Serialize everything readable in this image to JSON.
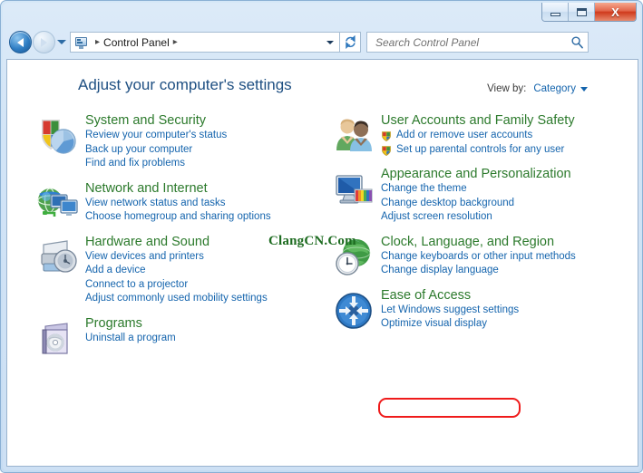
{
  "window": {
    "buttons": {
      "minimize": "minimize",
      "maximize": "maximize",
      "close": "X"
    }
  },
  "addressbar": {
    "icon": "control-panel-icon",
    "crumb": "Control Panel",
    "separator": "▸",
    "back_icon": "back-arrow-icon",
    "forward_icon": "forward-arrow-icon",
    "history_icon": "chevron-down-icon",
    "dropdown_icon": "chevron-down-icon",
    "refresh_icon": "refresh-icon"
  },
  "search": {
    "placeholder": "Search Control Panel",
    "value": "",
    "icon": "search-icon"
  },
  "main": {
    "title": "Adjust your computer's settings",
    "view_by_label": "View by:",
    "view_by_value": "Category",
    "view_by_caret": "chevron-down-icon"
  },
  "watermark": "ClangCN.Com",
  "highlight": {
    "color": "#ef1b1b",
    "target": "Change display language"
  },
  "colors": {
    "category_title": "#2c7a2c",
    "link": "#1464ad",
    "page_title": "#1e4f82",
    "highlight": "#ef1b1b",
    "watermark": "#1d6b20"
  },
  "categories_left": [
    {
      "title": "System and Security",
      "icon": "shield-security-icon",
      "links": [
        {
          "label": "Review your computer's status",
          "shield": false
        },
        {
          "label": "Back up your computer",
          "shield": false
        },
        {
          "label": "Find and fix problems",
          "shield": false
        }
      ]
    },
    {
      "title": "Network and Internet",
      "icon": "network-globe-icon",
      "links": [
        {
          "label": "View network status and tasks",
          "shield": false
        },
        {
          "label": "Choose homegroup and sharing options",
          "shield": false
        }
      ]
    },
    {
      "title": "Hardware and Sound",
      "icon": "printer-device-icon",
      "links": [
        {
          "label": "View devices and printers",
          "shield": false
        },
        {
          "label": "Add a device",
          "shield": false
        },
        {
          "label": "Connect to a projector",
          "shield": false
        },
        {
          "label": "Adjust commonly used mobility settings",
          "shield": false
        }
      ]
    },
    {
      "title": "Programs",
      "icon": "programs-box-icon",
      "links": [
        {
          "label": "Uninstall a program",
          "shield": false
        }
      ]
    }
  ],
  "categories_right": [
    {
      "title": "User Accounts and Family Safety",
      "icon": "users-icon",
      "links": [
        {
          "label": "Add or remove user accounts",
          "shield": true
        },
        {
          "label": "Set up parental controls for any user",
          "shield": true
        }
      ]
    },
    {
      "title": "Appearance and Personalization",
      "icon": "monitor-palette-icon",
      "links": [
        {
          "label": "Change the theme",
          "shield": false
        },
        {
          "label": "Change desktop background",
          "shield": false
        },
        {
          "label": "Adjust screen resolution",
          "shield": false
        }
      ]
    },
    {
      "title": "Clock, Language, and Region",
      "icon": "globe-clock-icon",
      "links": [
        {
          "label": "Change keyboards or other input methods",
          "shield": false
        },
        {
          "label": "Change display language",
          "shield": false
        }
      ]
    },
    {
      "title": "Ease of Access",
      "icon": "ease-of-access-icon",
      "links": [
        {
          "label": "Let Windows suggest settings",
          "shield": false
        },
        {
          "label": "Optimize visual display",
          "shield": false
        }
      ]
    }
  ]
}
